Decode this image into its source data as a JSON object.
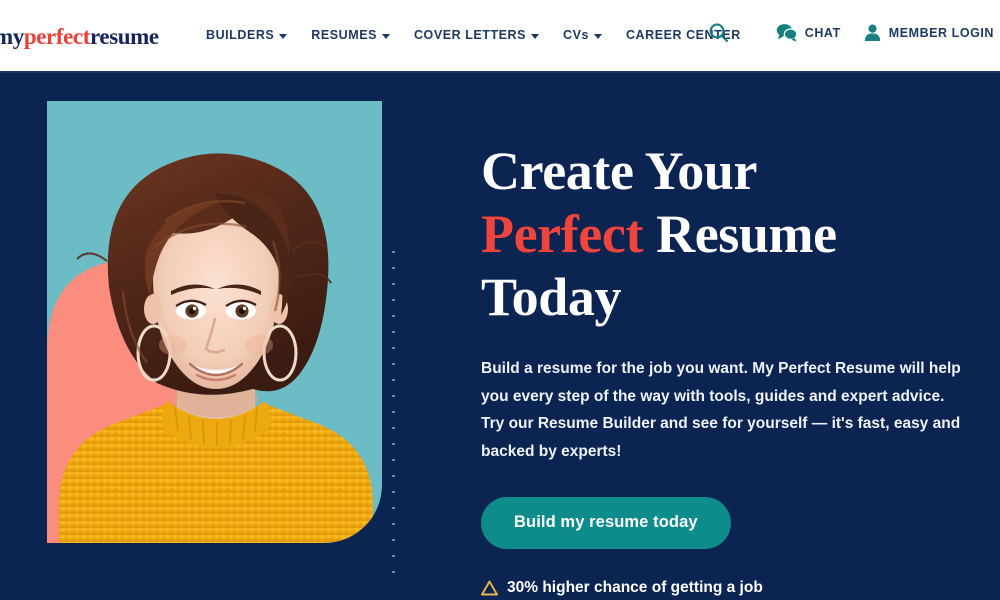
{
  "header": {
    "logo": {
      "part1": "my",
      "part2": "perfect",
      "part3": "resume"
    },
    "nav": [
      {
        "label": "BUILDERS",
        "has_caret": true
      },
      {
        "label": "RESUMES",
        "has_caret": true
      },
      {
        "label": "COVER LETTERS",
        "has_caret": true
      },
      {
        "label": "CVs",
        "has_caret": true
      },
      {
        "label": "CAREER CENTER",
        "has_caret": false
      }
    ],
    "utility": {
      "search_icon": "search-icon",
      "chat_icon": "chat-bubbles-icon",
      "chat_label": "CHAT",
      "member_icon": "person-icon",
      "member_label": "MEMBER LOGIN"
    }
  },
  "hero": {
    "headline_line1": "Create Your",
    "headline_red": "Perfect",
    "headline_line2_rest": " Resume",
    "headline_line3": "Today",
    "paragraph": "Build a resume for the job you want. My Perfect Resume will help you every step of the way with tools, guides and expert advice. Try our Resume Builder and see for yourself — it's fast, easy and backed by experts!",
    "cta_label": "Build my resume today",
    "proof_icon": "chevron-up-badge-icon",
    "proof_text": "30% higher chance of getting a job",
    "image_alt": "smiling-woman-in-yellow-sweater-photo"
  },
  "colors": {
    "navy": "#0c2451",
    "red": "#f0453c",
    "teal_button": "#0e8c8c",
    "teal_shape": "#6bbcc4",
    "coral_shape": "#fa8d7e",
    "gold": "#e8b54d",
    "white": "#ffffff"
  }
}
